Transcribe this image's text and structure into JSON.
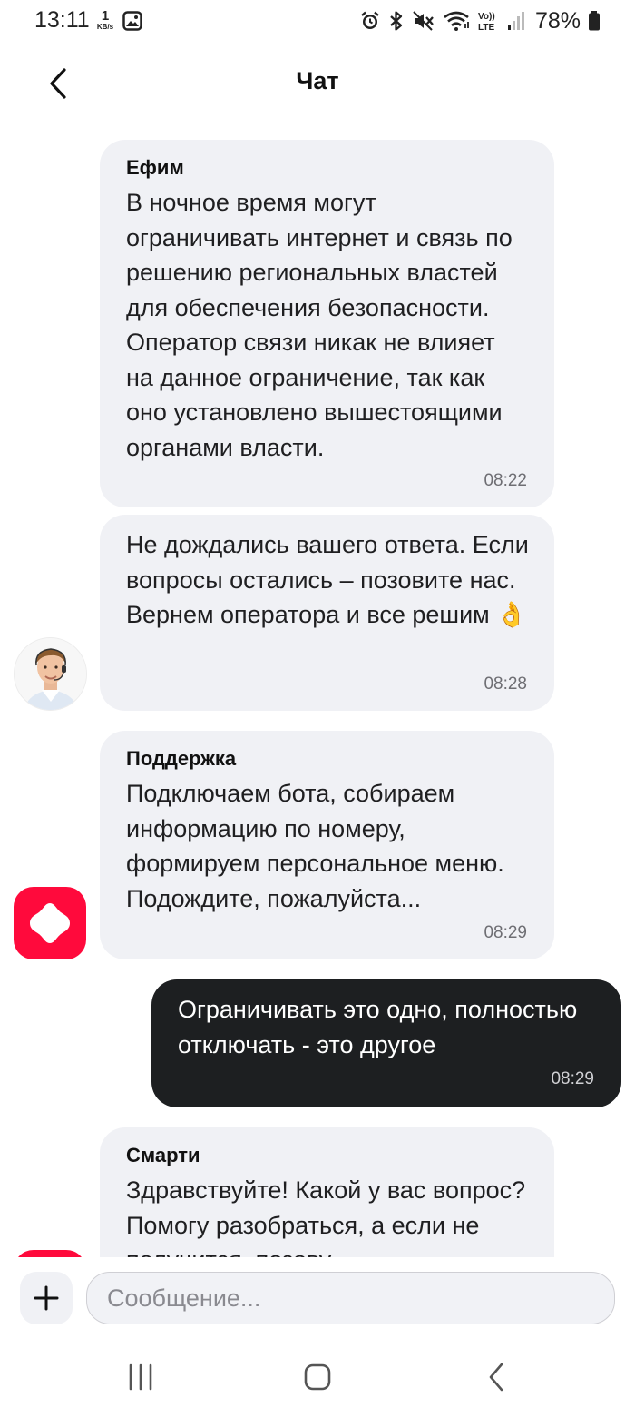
{
  "status_bar": {
    "time": "13:11",
    "data_rate_value": "1",
    "data_rate_unit": "KB/s",
    "battery": "78%",
    "icons": [
      "gallery-icon",
      "alarm-icon",
      "bluetooth-icon",
      "mute-icon",
      "wifi-icon",
      "volte-icon",
      "signal-icon",
      "battery-icon"
    ],
    "volte_label": "Vo)) LTE"
  },
  "header": {
    "title": "Чат",
    "back_icon": "chevron-left-icon"
  },
  "messages": [
    {
      "direction": "in",
      "sender": "Ефим",
      "text": "В ночное время могут ограничивать интернет и связь по решению региональных властей для обеспечения безопасности. Оператор связи никак не влияет на данное ограничение, так как оно установлено вышестоящими органами власти.",
      "time": "08:22"
    },
    {
      "direction": "in",
      "sender": "",
      "text": "Не дождались вашего ответа. Если вопросы остались – позовите нас. Вернем оператора и все решим 👌",
      "time": "08:28",
      "avatar": "operator-avatar"
    },
    {
      "direction": "in",
      "sender": "Поддержка",
      "text": "Подключаем бота, собираем информацию по номеру, формируем персональное меню. Подождите, пожалуйста...",
      "time": "08:29",
      "avatar": "bot-logo-icon"
    },
    {
      "direction": "out",
      "text": "Ограничивать это одно, полностью отключать - это другое",
      "time": "08:29"
    },
    {
      "direction": "in",
      "sender": "Смарти",
      "text": "Здравствуйте! Какой у вас вопрос? Помогу разобраться, а если не получится, позову",
      "avatar": "bot-logo-icon"
    }
  ],
  "composer": {
    "placeholder": "Сообщение...",
    "value": "",
    "add_icon": "plus-icon"
  },
  "nav_bar": {
    "icons": [
      "recent-apps-icon",
      "home-icon",
      "back-icon"
    ]
  },
  "colors": {
    "incoming_bubble": "#f0f1f5",
    "outgoing_bubble": "#1d1f21",
    "brand_red": "#ff0a3c"
  }
}
